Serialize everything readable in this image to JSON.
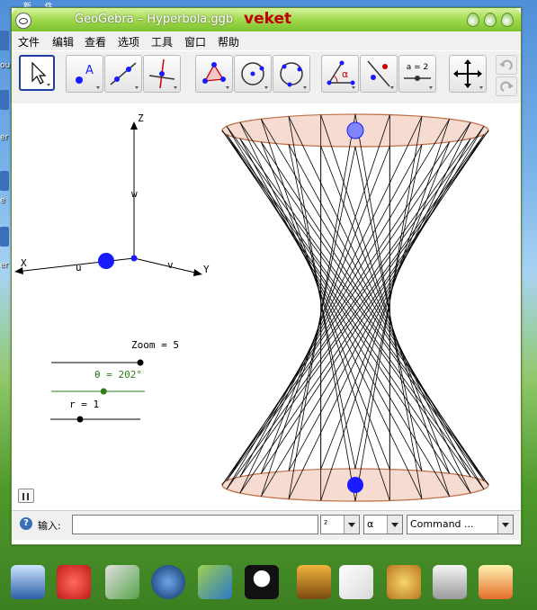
{
  "desktop": {
    "top_snippet": "… 新 … 件",
    "left_labels": [
      "ou",
      "er",
      "e",
      "er"
    ]
  },
  "window": {
    "title": "GeoGebra – Hyperbola.ggb",
    "brand": "veket"
  },
  "menu": [
    "文件",
    "编辑",
    "查看",
    "选项",
    "工具",
    "窗口",
    "帮助"
  ],
  "toolbar": {
    "tools": [
      {
        "name": "move",
        "icon": "arrow-cursor-icon"
      },
      {
        "name": "new-point",
        "icon": "point-A-icon"
      },
      {
        "name": "line",
        "icon": "line-through-two-points-icon"
      },
      {
        "name": "perpendicular",
        "icon": "perpendicular-line-icon"
      },
      {
        "name": "polygon",
        "icon": "polygon-icon"
      },
      {
        "name": "circle",
        "icon": "circle-center-point-icon"
      },
      {
        "name": "circle-three-points",
        "icon": "circle-three-points-icon"
      },
      {
        "name": "angle",
        "icon": "angle-icon"
      },
      {
        "name": "reflect",
        "icon": "reflect-about-line-icon"
      },
      {
        "name": "slider",
        "icon": "slider-icon"
      },
      {
        "name": "move-view",
        "icon": "move-graphics-view-icon"
      }
    ],
    "slider_tool_label": "a = 2",
    "angle_symbol": "α"
  },
  "canvas": {
    "axes": {
      "z": "Z",
      "w": "w",
      "x": "X",
      "u": "u",
      "v": "v",
      "y": "Y"
    },
    "sliders": {
      "zoom": {
        "label": "Zoom = 5",
        "fraction": 1.0
      },
      "theta": {
        "label": "θ = 202°",
        "fraction": 0.56
      },
      "r": {
        "label": "r = 1",
        "fraction": 0.33
      }
    },
    "surface": {
      "type": "hyperboloid-of-one-sheet",
      "rulings": 24,
      "twist_deg": 150
    },
    "colors": {
      "accent_green": "#2e7d18",
      "point_blue": "#1a1aff",
      "ellipse_stroke": "#c0704a",
      "ellipse_fill": "#f6dcd0"
    }
  },
  "input_bar": {
    "help": "?",
    "label": "输入:",
    "value": "",
    "combo_superscript": "²",
    "combo_greek": "α",
    "combo_command": "Command ..."
  }
}
